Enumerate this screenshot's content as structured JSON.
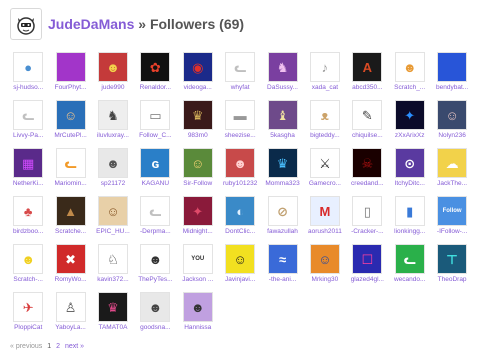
{
  "header": {
    "username": "JudeDaMans",
    "separator": "»",
    "title": "Followers (69)",
    "avatar_icon": "cat-face-icon"
  },
  "followers": [
    {
      "name": "sj-hudso...",
      "bg": "#ffffff",
      "fg": "#4a8fd1",
      "glyph": "●"
    },
    {
      "name": "FourPhyt...",
      "bg": "#a235c9",
      "fg": "#ffffff",
      "glyph": ""
    },
    {
      "name": "jude990",
      "bg": "#c43a3a",
      "fg": "#f2d24a",
      "glyph": "☻"
    },
    {
      "name": "Renaldor...",
      "bg": "#111111",
      "fg": "#e8402a",
      "glyph": "✿"
    },
    {
      "name": "videoga...",
      "bg": "#1b2a8a",
      "fg": "#e3302a",
      "glyph": "◉"
    },
    {
      "name": "whyfat",
      "bg": "#ffffff",
      "fg": "#bfbfbf",
      "glyph": "ᓚ"
    },
    {
      "name": "DaSussy...",
      "bg": "#7a3fa0",
      "fg": "#f0c0f0",
      "glyph": "♞"
    },
    {
      "name": "xada_cat",
      "bg": "#ffffff",
      "fg": "#999999",
      "glyph": "♪"
    },
    {
      "name": "abcd350...",
      "bg": "#1a1a1a",
      "fg": "#d84a24",
      "glyph": "A"
    },
    {
      "name": "Scratch_...",
      "bg": "#ffffff",
      "fg": "#e89a34",
      "glyph": "☻"
    },
    {
      "name": "bendybat...",
      "bg": "#2855d8",
      "fg": "#ffffff",
      "glyph": ""
    },
    {
      "name": "Livvy-Pa...",
      "bg": "#ffffff",
      "fg": "#c0c0c0",
      "glyph": "ᓚ"
    },
    {
      "name": "MrCutePl...",
      "bg": "#2a6fb8",
      "fg": "#f2c48a",
      "glyph": "☺"
    },
    {
      "name": "iluvluxray...",
      "bg": "#eeeeee",
      "fg": "#444444",
      "glyph": "♞"
    },
    {
      "name": "Follow_C...",
      "bg": "#ffffff",
      "fg": "#777777",
      "glyph": "▭"
    },
    {
      "name": "983m0",
      "bg": "#3a1a1a",
      "fg": "#d4b25a",
      "glyph": "♛"
    },
    {
      "name": "sheezise...",
      "bg": "#ffffff",
      "fg": "#999999",
      "glyph": "▬"
    },
    {
      "name": "5kasgha",
      "bg": "#6e4a8a",
      "fg": "#f0e0a0",
      "glyph": "♝"
    },
    {
      "name": "bigteddy...",
      "bg": "#ffffff",
      "fg": "#cca36a",
      "glyph": "ᴥ"
    },
    {
      "name": "chiquilse...",
      "bg": "#ffffff",
      "fg": "#444444",
      "glyph": "✎"
    },
    {
      "name": "zXxArixXz",
      "bg": "#0b0b2a",
      "fg": "#2a8fff",
      "glyph": "✦"
    },
    {
      "name": "Nolyn236",
      "bg": "#3a4a6e",
      "fg": "#e0c0c0",
      "glyph": "☺"
    },
    {
      "name": "NetherKi...",
      "bg": "#5a2a8a",
      "fg": "#d14aff",
      "glyph": "▦"
    },
    {
      "name": "Mariomin...",
      "bg": "#ffffff",
      "fg": "#f29a28",
      "glyph": "ᓚ"
    },
    {
      "name": "sp21172",
      "bg": "#e8e8e8",
      "fg": "#555555",
      "glyph": "☻"
    },
    {
      "name": "KAGANU",
      "bg": "#2a7fc8",
      "fg": "#ffffff",
      "glyph": "ɢ"
    },
    {
      "name": "Sir-Follow",
      "bg": "#5a8a3a",
      "fg": "#f0d070",
      "glyph": "☺"
    },
    {
      "name": "ruby101232",
      "bg": "#c84a4a",
      "fg": "#ffd0d0",
      "glyph": "☻"
    },
    {
      "name": "Momma323",
      "bg": "#0a2a4a",
      "fg": "#4ac0ff",
      "glyph": "♛"
    },
    {
      "name": "Gamecro...",
      "bg": "#ffffff",
      "fg": "#333333",
      "glyph": "⚔"
    },
    {
      "name": "creedand...",
      "bg": "#1a0000",
      "fg": "#aa1010",
      "glyph": "☠"
    },
    {
      "name": "ItchyDitc...",
      "bg": "#5a3aa0",
      "fg": "#ffffff",
      "glyph": "⊙"
    },
    {
      "name": "JackThe...",
      "bg": "#f2d24a",
      "fg": "#ffffff",
      "glyph": "☁"
    },
    {
      "name": "birdzboo...",
      "bg": "#ffffff",
      "fg": "#d84a4a",
      "glyph": "♣"
    },
    {
      "name": "Scratche...",
      "bg": "#3a2a1a",
      "fg": "#c08a4a",
      "glyph": "▲"
    },
    {
      "name": "EPIC_HU...",
      "bg": "#e8d0a8",
      "fg": "#8a5a2a",
      "glyph": "☺"
    },
    {
      "name": "-Derpma...",
      "bg": "#ffffff",
      "fg": "#c0c0c0",
      "glyph": "ᓚ"
    },
    {
      "name": "Midnight...",
      "bg": "#8a1a3a",
      "fg": "#e04a6a",
      "glyph": "✦"
    },
    {
      "name": "DontClic...",
      "bg": "#3a8ac8",
      "fg": "#e0f0ff",
      "glyph": "◐"
    },
    {
      "name": "fawazullah",
      "bg": "#ffffff",
      "fg": "#c0a070",
      "glyph": "⊘"
    },
    {
      "name": "aorush2011",
      "bg": "#e8f0ff",
      "fg": "#d82a2a",
      "glyph": "M"
    },
    {
      "name": "-Cracker-...",
      "bg": "#ffffff",
      "fg": "#777777",
      "glyph": "▯"
    },
    {
      "name": "lionkingg...",
      "bg": "#ffffff",
      "fg": "#3a7ad8",
      "glyph": "▮"
    },
    {
      "name": "-IFollow-...",
      "bg": "#4a90e2",
      "fg": "#ffffff",
      "glyph": "Follow"
    },
    {
      "name": "Scratch-...",
      "bg": "#ffffff",
      "fg": "#f0d020",
      "glyph": "☻"
    },
    {
      "name": "RomyWo...",
      "bg": "#d02a2a",
      "fg": "#ffffff",
      "glyph": "✖"
    },
    {
      "name": "kavin372...",
      "bg": "#ffffff",
      "fg": "#222222",
      "glyph": "♘"
    },
    {
      "name": "ThePyTes...",
      "bg": "#ffffff",
      "fg": "#333333",
      "glyph": "☻"
    },
    {
      "name": "Jackson ...",
      "bg": "#ffffff",
      "fg": "#333333",
      "glyph": "YOU"
    },
    {
      "name": "Javinjavi...",
      "bg": "#f2e020",
      "fg": "#222222",
      "glyph": "☺"
    },
    {
      "name": "-the-ani...",
      "bg": "#3a6ad8",
      "fg": "#ffffff",
      "glyph": "≈"
    },
    {
      "name": "Mrking30",
      "bg": "#e88a2a",
      "fg": "#2a4aa0",
      "glyph": "☺"
    },
    {
      "name": "glazed4gl...",
      "bg": "#2a2ab0",
      "fg": "#ff40a0",
      "glyph": "☐"
    },
    {
      "name": "wecando...",
      "bg": "#2ab04a",
      "fg": "#ffffff",
      "glyph": "ᓚ"
    },
    {
      "name": "TheoDrap",
      "bg": "#1a5a7a",
      "fg": "#40e0e0",
      "glyph": "⊤"
    },
    {
      "name": "PloppiCat",
      "bg": "#ffffff",
      "fg": "#d83a3a",
      "glyph": "✈"
    },
    {
      "name": "YaboyLa...",
      "bg": "#ffffff",
      "fg": "#555555",
      "glyph": "♙"
    },
    {
      "name": "TAMAT0A",
      "bg": "#1a1a1a",
      "fg": "#e04a8a",
      "glyph": "♛"
    },
    {
      "name": "goodsna...",
      "bg": "#e8e8e8",
      "fg": "#444444",
      "glyph": "☻"
    },
    {
      "name": "Hannissa",
      "bg": "#c0a0e0",
      "fg": "#333333",
      "glyph": "☻"
    }
  ],
  "pager": {
    "previous": "« previous",
    "current": "1",
    "page2": "2",
    "next": "next »"
  }
}
